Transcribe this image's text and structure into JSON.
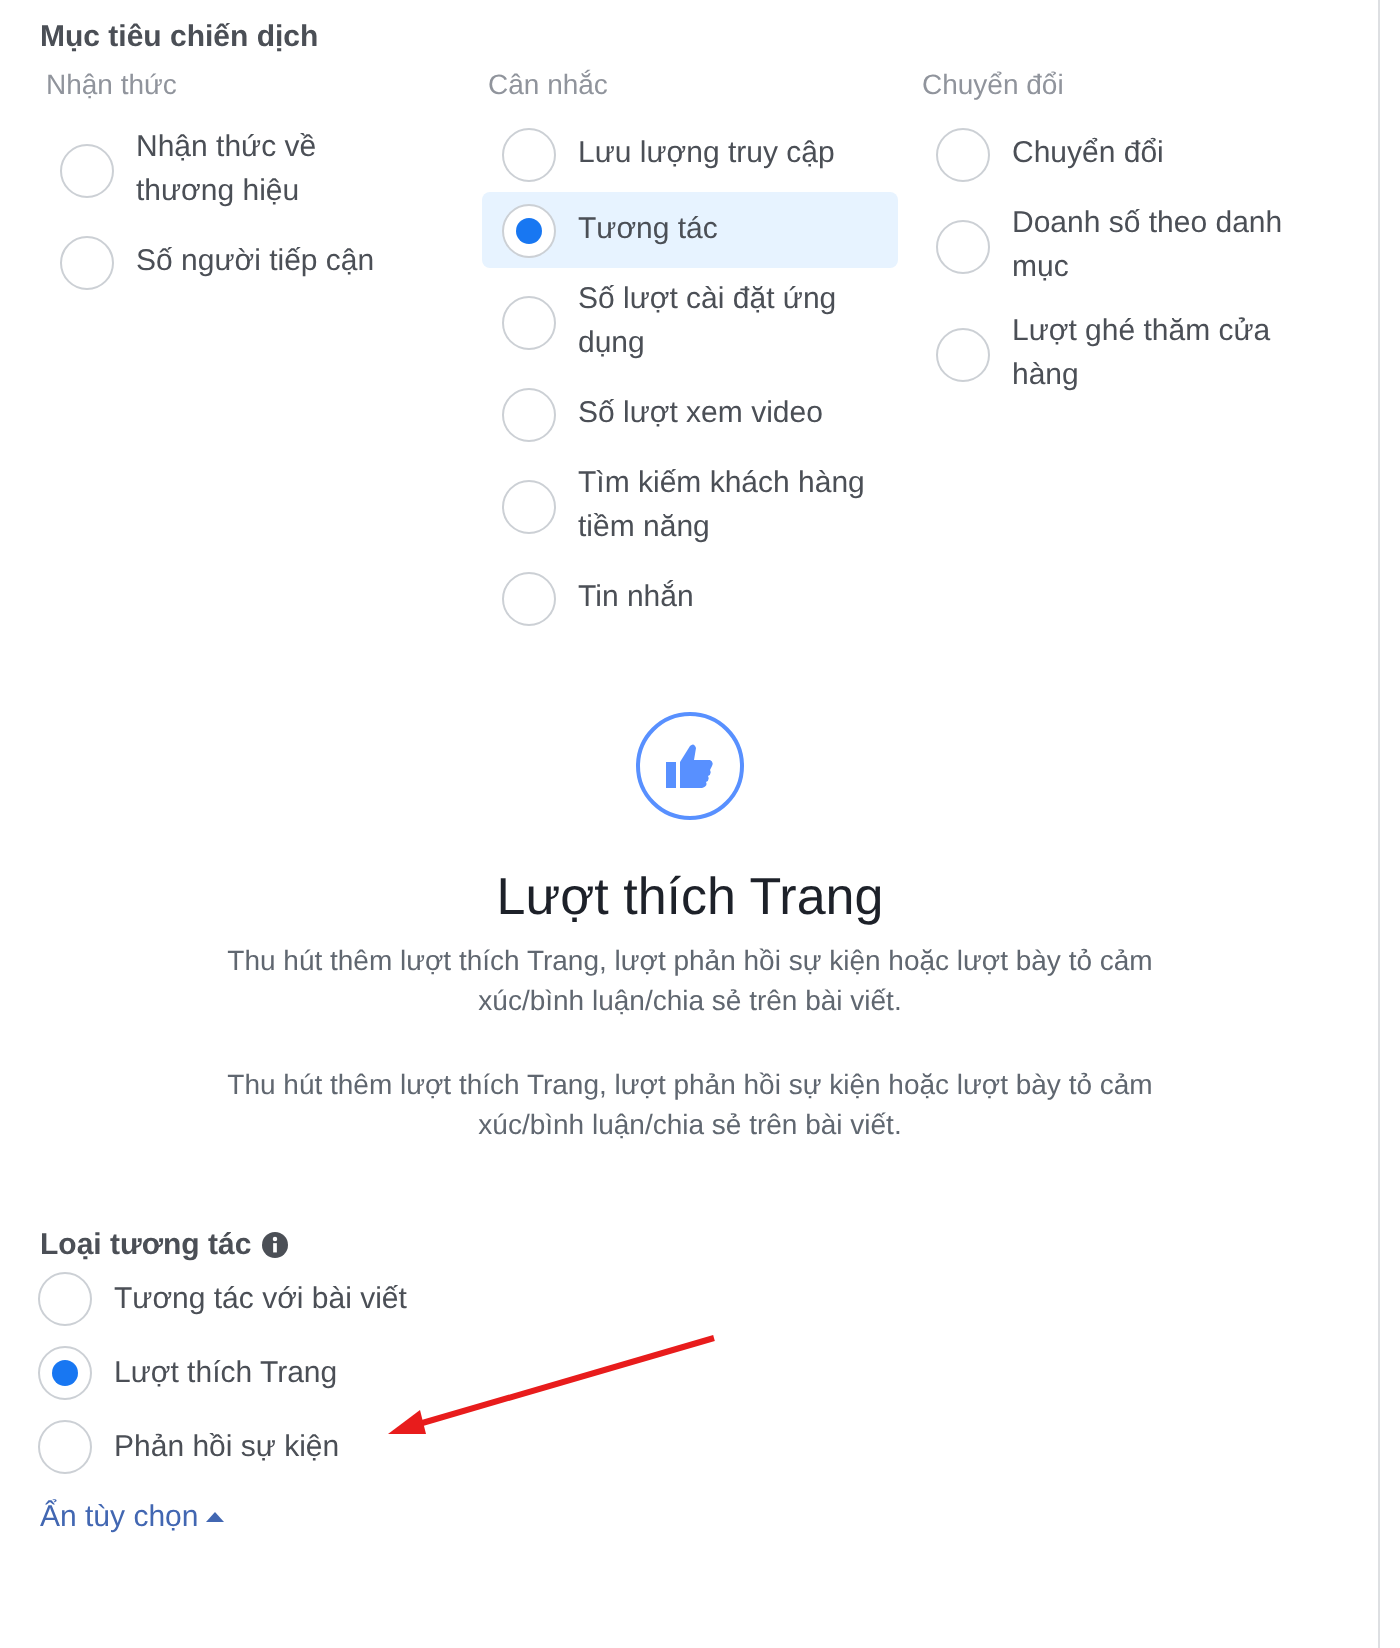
{
  "objective": {
    "title": "Mục tiêu chiến dịch",
    "columns": [
      {
        "heading": "Nhận thức",
        "options": [
          {
            "label": "Nhận thức về thương hiệu",
            "selected": false
          },
          {
            "label": "Số người tiếp cận",
            "selected": false
          }
        ]
      },
      {
        "heading": "Cân nhắc",
        "options": [
          {
            "label": "Lưu lượng truy cập",
            "selected": false
          },
          {
            "label": "Tương tác",
            "selected": true
          },
          {
            "label": "Số lượt cài đặt ứng dụng",
            "selected": false
          },
          {
            "label": "Số lượt xem video",
            "selected": false
          },
          {
            "label": "Tìm kiếm khách hàng tiềm năng",
            "selected": false
          },
          {
            "label": "Tin nhắn",
            "selected": false
          }
        ]
      },
      {
        "heading": "Chuyển đổi",
        "options": [
          {
            "label": "Chuyển đổi",
            "selected": false
          },
          {
            "label": "Doanh số theo danh mục",
            "selected": false
          },
          {
            "label": "Lượt ghé thăm cửa hàng",
            "selected": false
          }
        ]
      }
    ]
  },
  "detail": {
    "title": "Lượt thích Trang",
    "descriptions": [
      "Thu hút thêm lượt thích Trang, lượt phản hồi sự kiện hoặc lượt bày tỏ cảm xúc/bình luận/chia sẻ trên bài viết.",
      "Thu hút thêm lượt thích Trang, lượt phản hồi sự kiện hoặc lượt bày tỏ cảm xúc/bình luận/chia sẻ trên bài viết."
    ]
  },
  "engagement": {
    "title": "Loại tương tác",
    "options": [
      {
        "label": "Tương tác với bài viết",
        "selected": false
      },
      {
        "label": "Lượt thích Trang",
        "selected": true
      },
      {
        "label": "Phản hồi sự kiện",
        "selected": false
      }
    ],
    "toggle": {
      "label": "Ẩn tùy chọn",
      "expanded": true
    }
  }
}
